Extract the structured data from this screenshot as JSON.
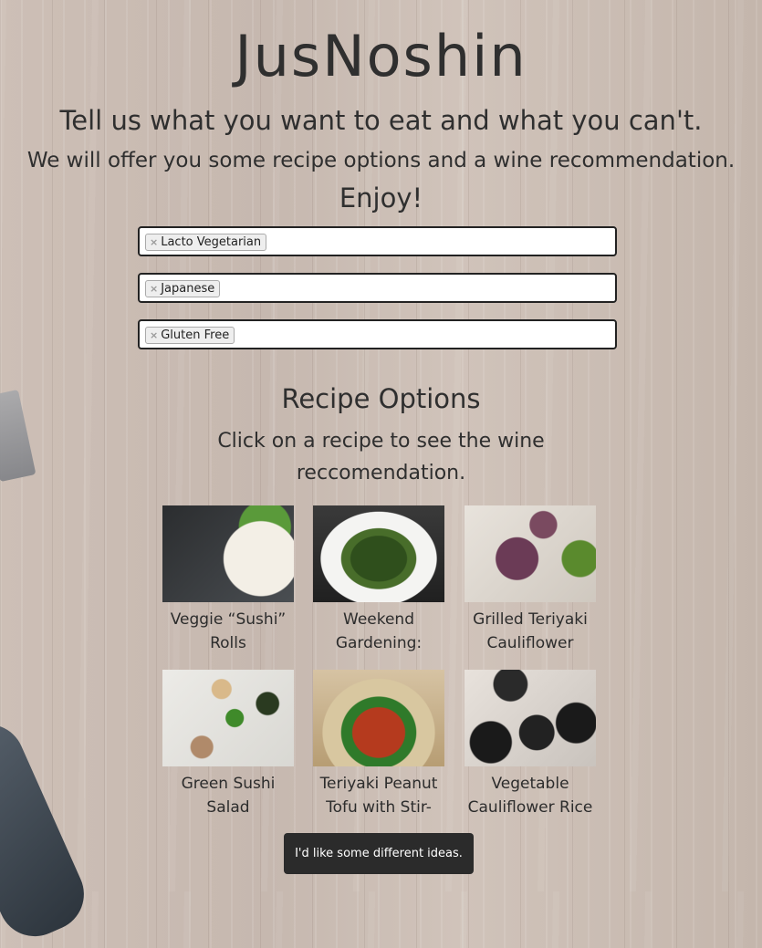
{
  "header": {
    "title": "JusNoshin",
    "tagline1": "Tell us what you want to eat and what you can't.",
    "tagline2": "We will offer you some recipe options and a wine recommendation.",
    "tagline3": "Enjoy!"
  },
  "filters": [
    {
      "tag": "Lacto Vegetarian",
      "remove_glyph": "×"
    },
    {
      "tag": "Japanese",
      "remove_glyph": "×"
    },
    {
      "tag": "Gluten Free",
      "remove_glyph": "×"
    }
  ],
  "recipes_section": {
    "title": "Recipe Options",
    "instruction": "Click on a recipe to see the wine reccomendation."
  },
  "recipes": [
    {
      "title": "Veggie “Sushi” Rolls"
    },
    {
      "title": "Weekend Gardening:"
    },
    {
      "title": "Grilled Teriyaki Cauliflower"
    },
    {
      "title": "Green Sushi Salad"
    },
    {
      "title": "Teriyaki Peanut Tofu with Stir-"
    },
    {
      "title": "Vegetable Cauliflower Rice"
    }
  ],
  "actions": {
    "different_ideas_label": "I'd like some different ideas."
  }
}
